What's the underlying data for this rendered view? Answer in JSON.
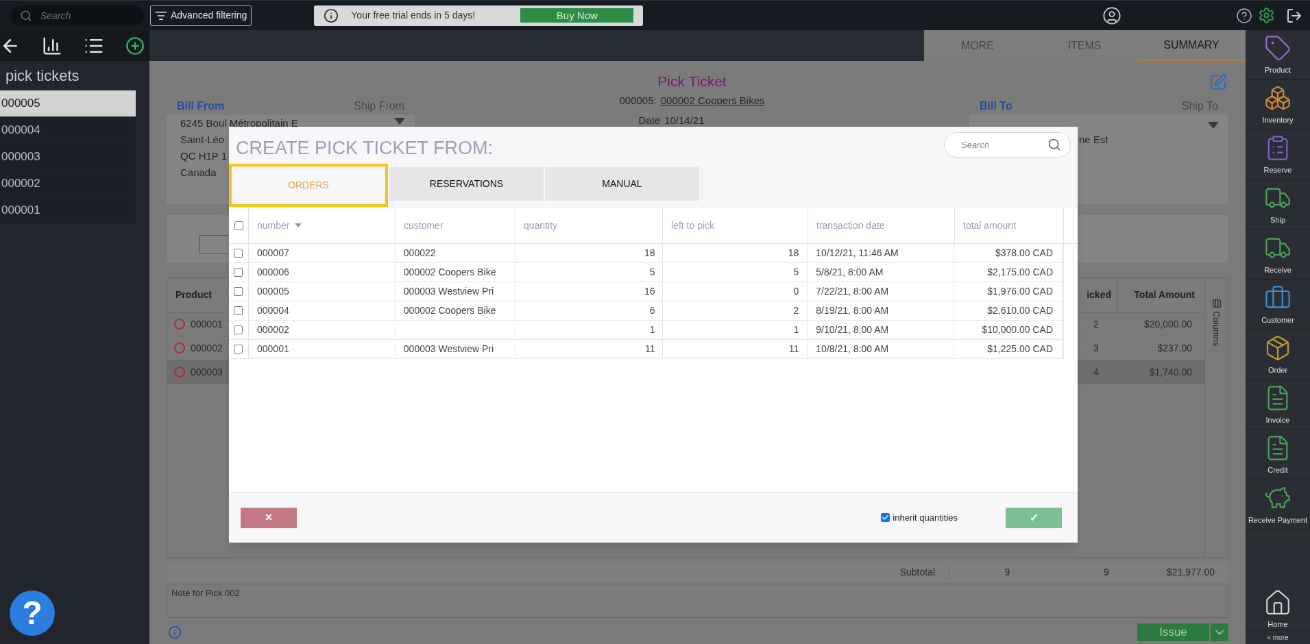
{
  "top_bar": {
    "search": {
      "placeholder": "Search"
    },
    "filter_button": "Advanced filtering",
    "trial_banner": {
      "message": "Your free trial ends in 5 days!",
      "button": "Buy Now"
    }
  },
  "sidebar": {
    "title": "pick tickets",
    "items": [
      {
        "label": "000005",
        "selected": true
      },
      {
        "label": "000004",
        "selected": false
      },
      {
        "label": "000003",
        "selected": false
      },
      {
        "label": "000002",
        "selected": false
      },
      {
        "label": "000001",
        "selected": false
      }
    ],
    "help_button": "?"
  },
  "tabs": [
    {
      "label": "MORE",
      "selected": false
    },
    {
      "label": "ITEMS",
      "selected": false
    },
    {
      "label": "SUMMARY",
      "selected": true
    }
  ],
  "document": {
    "title": "Pick Ticket",
    "number": "000005:",
    "customer_link": "000002 Coopers Bikes",
    "date_label": "Date",
    "date": "10/14/21",
    "bill_from": {
      "label": "Bill From",
      "alt_label": "Ship From",
      "lines": [
        "6245 Boul Métropolitain E",
        "Saint-Léo",
        "QC H1P 1",
        "Canada"
      ]
    },
    "bill_to": {
      "label": "Bill To",
      "alt_label": "Ship To",
      "lines": [
        "ne Est"
      ]
    }
  },
  "items_table": {
    "columns": [
      "Product",
      "icked",
      "Total Amount"
    ],
    "rows": [
      {
        "product": "000001",
        "picked": "2",
        "total": "$20,000.00",
        "selected": false
      },
      {
        "product": "000002",
        "picked": "3",
        "total": "$237.00",
        "selected": false
      },
      {
        "product": "000003",
        "picked": "4",
        "total": "$1,740.00",
        "selected": true
      }
    ],
    "columns_tab": "Columns",
    "subtotal": {
      "label": "Subtotal",
      "values": [
        "9",
        "9",
        "$21,977.00"
      ]
    }
  },
  "note": "Note for Pick 002",
  "issue_button": "Issue",
  "modal": {
    "title": "CREATE PICK TICKET FROM:",
    "search": {
      "placeholder": "Search"
    },
    "tabs": [
      {
        "label": "ORDERS",
        "selected": true
      },
      {
        "label": "RESERVATIONS",
        "selected": false
      },
      {
        "label": "MANUAL",
        "selected": false
      }
    ],
    "select_all": {
      "checked": false
    },
    "columns": [
      "number",
      "customer",
      "quantity",
      "left to pick",
      "transaction date",
      "total amount"
    ],
    "rows": [
      {
        "checked": false,
        "cells": [
          "000007",
          "000022",
          "18",
          "18",
          "10/12/21, 11:46 AM",
          "$378.00 CAD"
        ]
      },
      {
        "checked": false,
        "cells": [
          "000006",
          "000002 Coopers Bike",
          "5",
          "5",
          "5/8/21, 8:00 AM",
          "$2,175.00 CAD"
        ]
      },
      {
        "checked": false,
        "cells": [
          "000005",
          "000003 Westview Pri",
          "16",
          "0",
          "7/22/21, 8:00 AM",
          "$1,976.00 CAD"
        ]
      },
      {
        "checked": false,
        "cells": [
          "000004",
          "000002 Coopers Bike",
          "6",
          "2",
          "8/19/21, 8:00 AM",
          "$2,610.00 CAD"
        ]
      },
      {
        "checked": false,
        "cells": [
          "000002",
          "",
          "1",
          "1",
          "9/10/21, 8:00 AM",
          "$10,000.00 CAD"
        ]
      },
      {
        "checked": false,
        "cells": [
          "000001",
          "000003 Westview Pri",
          "11",
          "11",
          "10/8/21, 8:00 AM",
          "$1,225.00 CAD"
        ]
      }
    ],
    "cancel_button": "×",
    "inherit": {
      "label": "inherit quantities",
      "checked": true
    },
    "confirm_button": "✓"
  },
  "right_nav": {
    "items": [
      "Product",
      "Inventory",
      "Reserve",
      "Ship",
      "Receive",
      "Customer",
      "Order",
      "Invoice",
      "Credit",
      "Receive Payment"
    ],
    "home": "Home",
    "more": "« more"
  }
}
